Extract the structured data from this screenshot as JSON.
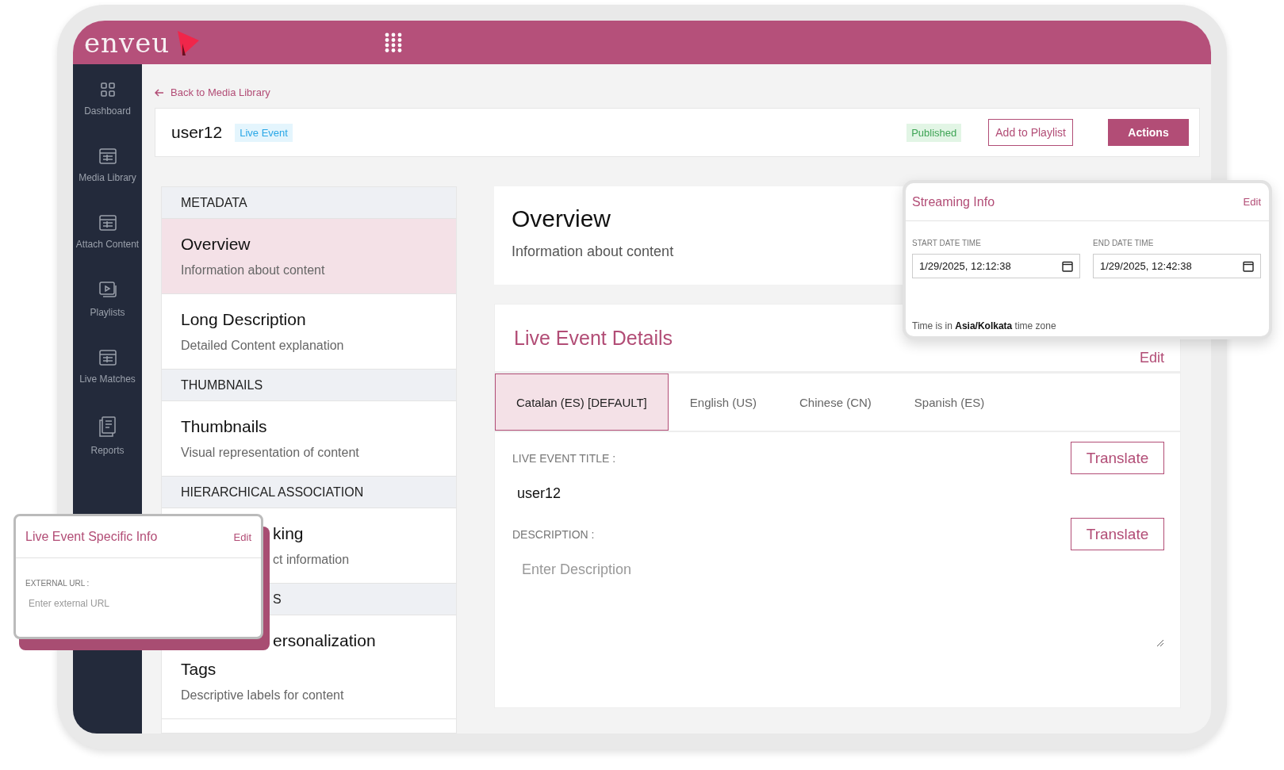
{
  "header": {
    "logo": "enveu"
  },
  "sidebar": {
    "items": [
      {
        "label": "Dashboard",
        "kind": "grid"
      },
      {
        "label": "Media Library",
        "kind": "table"
      },
      {
        "label": "Attach Content",
        "kind": "table"
      },
      {
        "label": "Playlists",
        "kind": "playlist"
      },
      {
        "label": "Live Matches",
        "kind": "table"
      },
      {
        "label": "Reports",
        "kind": "report"
      }
    ]
  },
  "back_link": "Back to Media Library",
  "title_bar": {
    "title": "user12",
    "type_badge": "Live Event",
    "status": "Published",
    "buttons": [
      {
        "label": "Add to Playlist",
        "kind": "outline"
      },
      {
        "label": "Actions",
        "kind": "primary"
      }
    ]
  },
  "sections": [
    {
      "kind": "header",
      "text": "METADATA"
    },
    {
      "kind": "item",
      "selected": true,
      "lines": [
        {
          "kind": "title",
          "text": "Overview"
        },
        {
          "kind": "desc",
          "text": "Information about content"
        }
      ]
    },
    {
      "kind": "item",
      "selected": false,
      "lines": [
        {
          "kind": "title",
          "text": "Long Description"
        },
        {
          "kind": "desc",
          "text": "Detailed Content explanation"
        }
      ]
    },
    {
      "kind": "header",
      "text": "THUMBNAILS"
    },
    {
      "kind": "item",
      "selected": false,
      "lines": [
        {
          "kind": "title",
          "text": "Thumbnails"
        },
        {
          "kind": "desc",
          "text": "Visual representation of content"
        }
      ]
    },
    {
      "kind": "header",
      "text": "HIERARCHICAL ASSOCIATION"
    },
    {
      "kind": "item",
      "selected": false,
      "lines": [
        {
          "kind": "title",
          "text": "king",
          "covered": true
        },
        {
          "kind": "desc",
          "text": "ct information",
          "covered": true
        }
      ]
    },
    {
      "kind": "header",
      "text": "S",
      "covered": true
    },
    {
      "kind": "item",
      "selected": false,
      "lines": [
        {
          "kind": "title",
          "text": "ersonalization",
          "covered": true
        },
        {
          "kind": "title",
          "text": "Tags"
        },
        {
          "kind": "desc",
          "text": "Descriptive labels for content"
        }
      ]
    }
  ],
  "overview": {
    "title": "Overview",
    "subtitle": "Information about content"
  },
  "details": {
    "title": "Live Event Details",
    "edit": "Edit",
    "tabs": [
      {
        "label": "Catalan (ES) [DEFAULT]",
        "selected": true
      },
      {
        "label": "English (US)",
        "selected": false
      },
      {
        "label": "Chinese (CN)",
        "selected": false
      },
      {
        "label": "Spanish (ES)",
        "selected": false
      }
    ],
    "fields": [
      {
        "label": "LIVE EVENT TITLE :",
        "kind": "text",
        "value": "user12",
        "button": "Translate"
      },
      {
        "label": "DESCRIPTION :",
        "kind": "textarea",
        "placeholder": "Enter Description",
        "button": "Translate"
      }
    ]
  },
  "streaming_info": {
    "title": "Streaming Info",
    "edit": "Edit",
    "fields": [
      {
        "label": "START DATE TIME",
        "value": "1/29/2025, 12:12:38"
      },
      {
        "label": "END DATE TIME",
        "value": "1/29/2025, 12:42:38"
      }
    ],
    "note": "Time is in **Asia/Kolkata** time zone"
  },
  "specific_info": {
    "title": "Live Event Specific Info",
    "edit": "Edit",
    "field_label": "EXTERNAL URL :",
    "placeholder": "Enter external URL"
  }
}
